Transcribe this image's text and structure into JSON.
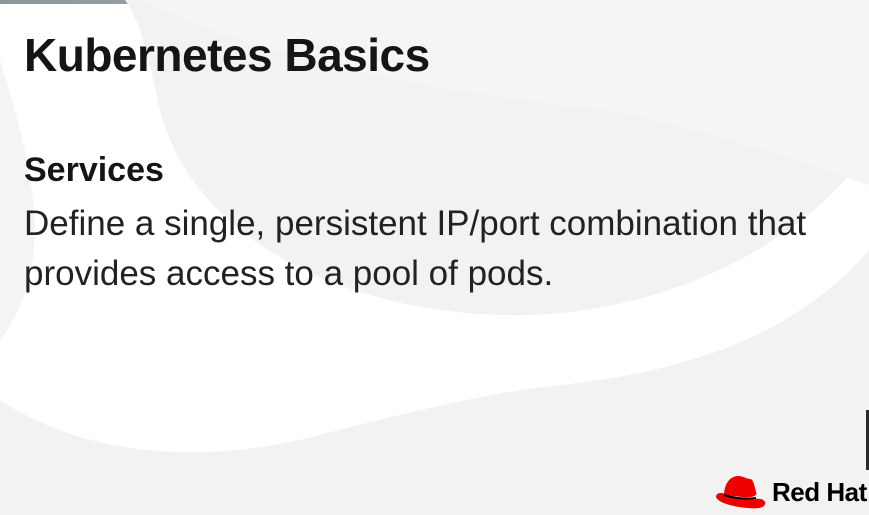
{
  "slide": {
    "title": "Kubernetes Basics",
    "section_heading": "Services",
    "section_body": "Define a single, persistent IP/port combination that provides access to a pool of pods."
  },
  "branding": {
    "logo_text": "Red Hat",
    "logo_icon": "red-hat-fedora-icon",
    "brand_color": "#ee0000"
  },
  "colors": {
    "background": "#ffffff",
    "background_shape": "#f2f2f2",
    "text": "#151515"
  }
}
